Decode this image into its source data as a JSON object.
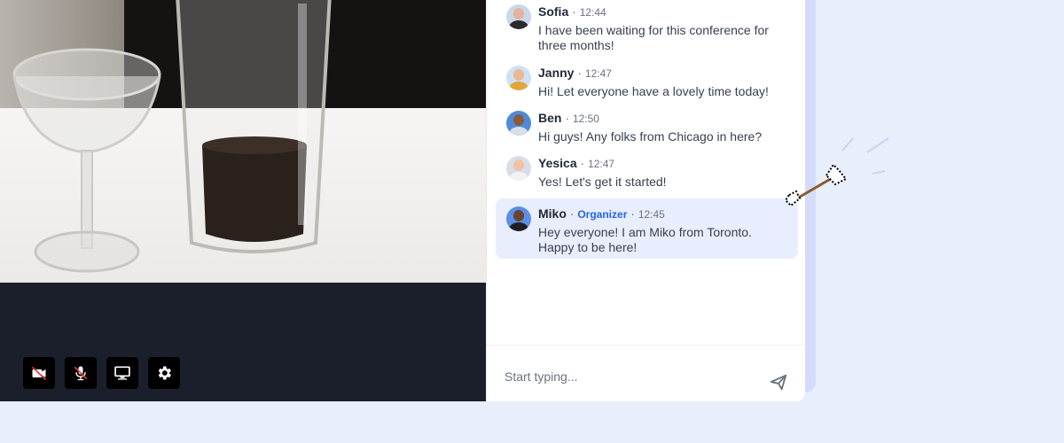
{
  "video": {
    "controls": [
      {
        "name": "camera-off-button",
        "icon": "video-off-icon"
      },
      {
        "name": "mic-off-button",
        "icon": "mic-off-icon"
      },
      {
        "name": "share-screen-button",
        "icon": "monitor-icon"
      },
      {
        "name": "settings-button",
        "icon": "gear-icon"
      }
    ]
  },
  "chat": {
    "messages": [
      {
        "name": "Sofia",
        "role": "",
        "time": "12:44",
        "text": "I have been waiting for this conference for three months!",
        "avatar_color": "#c9d7e8"
      },
      {
        "name": "Janny",
        "role": "",
        "time": "12:47",
        "text": "Hi! Let everyone have a lovely time today!",
        "avatar_color": "#cfe0f5"
      },
      {
        "name": "Ben",
        "role": "",
        "time": "12:50",
        "text": "Hi guys! Any folks from Chicago in here?",
        "avatar_color": "#4f8bd9"
      },
      {
        "name": "Yesica",
        "role": "",
        "time": "12:47",
        "text": "Yes! Let's get it started!",
        "avatar_color": "#d9dde6"
      },
      {
        "name": "Miko",
        "role": "Organizer",
        "time": "12:45",
        "text": "Hey everyone! I am Miko from Toronto. Happy to be here!",
        "avatar_color": "#5b8ee6"
      }
    ],
    "composer": {
      "placeholder": "Start typing..."
    }
  },
  "colors": {
    "background": "#e9eefd",
    "highlight": "#e8eefd",
    "organizer": "#2563eb"
  }
}
